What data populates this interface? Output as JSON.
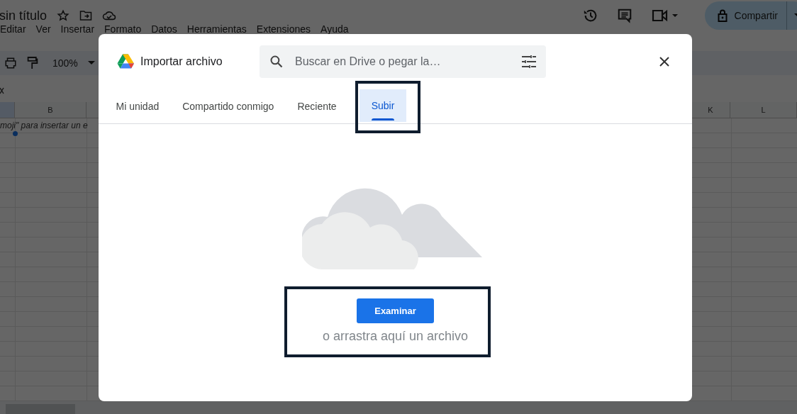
{
  "document": {
    "title": "sin título"
  },
  "menu": [
    "Editar",
    "Ver",
    "Insertar",
    "Formato",
    "Datos",
    "Herramientas",
    "Extensiones",
    "Ayuda"
  ],
  "toolbar": {
    "zoom": "100%"
  },
  "share_button": {
    "label": "Compartir"
  },
  "sheet": {
    "columns": [
      {
        "selected": true
      },
      {
        "label": "B",
        "selected": false
      },
      {
        "label": "K",
        "selected": false
      },
      {
        "label": "L",
        "selected": false
      }
    ],
    "cell_text": "moji\" para insertar un e"
  },
  "dialog": {
    "title": "Importar archivo",
    "search": {
      "placeholder": "Buscar en Drive o pegar la…"
    },
    "tabs": [
      {
        "label": "Mi unidad",
        "selected": false
      },
      {
        "label": "Compartido conmigo",
        "selected": false
      },
      {
        "label": "Reciente",
        "selected": false
      },
      {
        "label": "Subir",
        "selected": true
      }
    ],
    "browse_button": "Examinar",
    "drop_hint": "o arrastra aquí un archivo"
  }
}
